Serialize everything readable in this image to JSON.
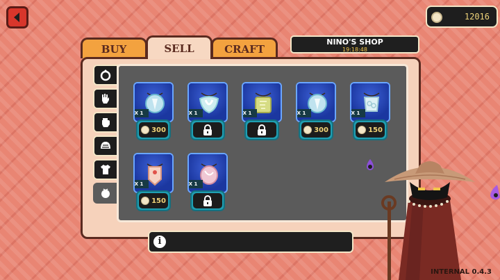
{
  "currency": {
    "amount": "12016",
    "icon": "coin-icon"
  },
  "shop": {
    "title": "NINO'S SHOP",
    "clock": "19:18:48"
  },
  "tabs": [
    {
      "label": "BUY"
    },
    {
      "label": "SELL"
    },
    {
      "label": "CRAFT"
    }
  ],
  "active_tab": "SELL",
  "categories": [
    "ring-icon",
    "glove-icon",
    "fist-icon",
    "helmet-icon",
    "shirt-icon",
    "amulet-icon"
  ],
  "items": [
    {
      "qty": "X 1",
      "price": "300",
      "locked": false,
      "color": "#bfe3ef"
    },
    {
      "qty": "X 1",
      "price": "",
      "locked": true,
      "color": "#cfeef0"
    },
    {
      "qty": "X 1",
      "price": "",
      "locked": true,
      "color": "#d6dc84"
    },
    {
      "qty": "X 1",
      "price": "300",
      "locked": false,
      "color": "#bfe3ef"
    },
    {
      "qty": "X 1",
      "price": "150",
      "locked": false,
      "color": "#dff1f5"
    },
    {
      "qty": "X 1",
      "price": "150",
      "locked": false,
      "color": "#f6d3c4"
    },
    {
      "qty": "X 1",
      "price": "",
      "locked": true,
      "color": "#f0c7d4"
    }
  ],
  "info": {
    "text": ""
  },
  "version": "INTERNAL 0.4.3"
}
